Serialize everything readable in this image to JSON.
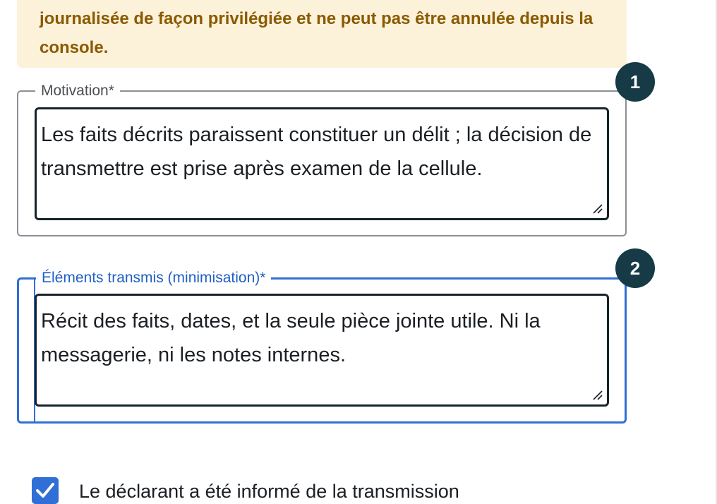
{
  "warning": {
    "text": "journalisée de façon privilégiée et ne peut pas être annulée depuis la console."
  },
  "fields": [
    {
      "step": "1",
      "label": "Motivation*",
      "value": "Les faits décrits paraissent constituer un délit ; la décision de transmettre est prise après examen de la cellule."
    },
    {
      "step": "2",
      "label": "Éléments transmis (minimisation)*",
      "value": "Récit des faits, dates, et la seule pièce jointe utile. Ni la messagerie, ni les notes internes."
    }
  ],
  "consent": {
    "label": "Le déclarant a été informé de la transmission",
    "checked": true
  },
  "colors": {
    "warning_bg": "#fcf1d9",
    "warning_text": "#8a5a00",
    "focus_blue": "#2f6fd6",
    "badge_bg": "#163a46"
  },
  "icons": {
    "resize": "resize-grip-icon",
    "check": "checkmark-icon"
  }
}
